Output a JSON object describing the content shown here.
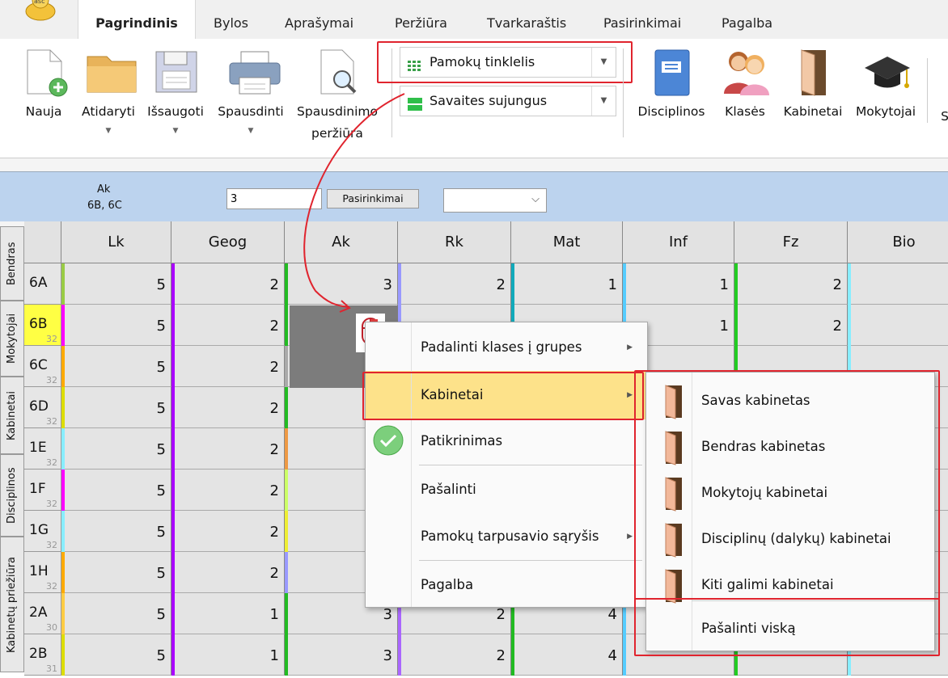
{
  "app": {
    "logo_text": "asc"
  },
  "menu_tabs": [
    "Pagrindinis",
    "Bylos",
    "Aprašymai",
    "Peržiūra",
    "Tvarkaraštis",
    "Pasirinkimai",
    "Pagalba"
  ],
  "ribbon": {
    "buttons": [
      {
        "line1": "Nauja",
        "line2": "",
        "icon": "new-file-icon"
      },
      {
        "line1": "Atidaryti",
        "line2": "",
        "icon": "folder-icon"
      },
      {
        "line1": "Išsaugoti",
        "line2": "",
        "icon": "floppy-icon"
      },
      {
        "line1": "Spausdinti",
        "line2": "",
        "icon": "printer-icon"
      },
      {
        "line1": "Spausdinimo",
        "line2": "peržiūra",
        "icon": "print-preview-icon"
      }
    ],
    "combo1": "Pamokų tinklelis",
    "combo2": "Savaites sujungus",
    "right_buttons": [
      "Disciplinos",
      "Klasės",
      "Kabinetai",
      "Mokytojai",
      "S"
    ]
  },
  "strip": {
    "label1": "Ak",
    "label2": "6B, 6C",
    "input_value": "3",
    "options_button": "Pasirinkimai",
    "select_value": ""
  },
  "side_tabs": [
    "Bendras",
    "Mokytojai",
    "Kabinetai",
    "Disciplinos",
    "Kabinetų priežiūra"
  ],
  "grid": {
    "columns": [
      "Lk",
      "Geog",
      "Ak",
      "Rk",
      "Mat",
      "Inf",
      "Fz",
      "Bio"
    ],
    "rows": [
      {
        "name": "6A",
        "count": "",
        "values": [
          "5",
          "2",
          "3",
          "2",
          "1",
          "1",
          "2",
          ""
        ]
      },
      {
        "name": "6B",
        "count": "32",
        "values": [
          "5",
          "2",
          "",
          "",
          "",
          "1",
          "2",
          ""
        ]
      },
      {
        "name": "6C",
        "count": "32",
        "values": [
          "5",
          "2",
          "",
          "",
          "",
          "",
          "",
          ""
        ]
      },
      {
        "name": "6D",
        "count": "32",
        "values": [
          "5",
          "2",
          "",
          "",
          "",
          "",
          "",
          ""
        ]
      },
      {
        "name": "1E",
        "count": "32",
        "values": [
          "5",
          "2",
          "",
          "",
          "",
          "",
          "",
          ""
        ]
      },
      {
        "name": "1F",
        "count": "32",
        "values": [
          "5",
          "2",
          "",
          "",
          "",
          "",
          "",
          ""
        ]
      },
      {
        "name": "1G",
        "count": "32",
        "values": [
          "5",
          "2",
          "",
          "",
          "",
          "",
          "",
          ""
        ]
      },
      {
        "name": "1H",
        "count": "32",
        "values": [
          "5",
          "2",
          "",
          "",
          "",
          "",
          "",
          ""
        ]
      },
      {
        "name": "2A",
        "count": "30",
        "values": [
          "5",
          "1",
          "3",
          "2",
          "4",
          "",
          "",
          ""
        ]
      },
      {
        "name": "2B",
        "count": "31",
        "values": [
          "5",
          "1",
          "3",
          "2",
          "4",
          "",
          "",
          ""
        ]
      }
    ]
  },
  "context_menu": {
    "items": [
      "Padalinti klases į grupes",
      "Kabinetai",
      "Patikrinimas",
      "Pašalinti",
      "Pamokų tarpusavio sąryšis",
      "Pagalba"
    ]
  },
  "submenu": {
    "items": [
      "Savas kabinetas",
      "Bendras kabinetas",
      "Mokytojų kabinetai",
      "Disciplinų (dalykų) kabinetai",
      "Kiti galimi kabinetai",
      "Pašalinti viską"
    ]
  },
  "colors": {
    "highlight": "#e0242e",
    "menu_hover": "#fde28a",
    "strip": "#bcd3ee"
  }
}
